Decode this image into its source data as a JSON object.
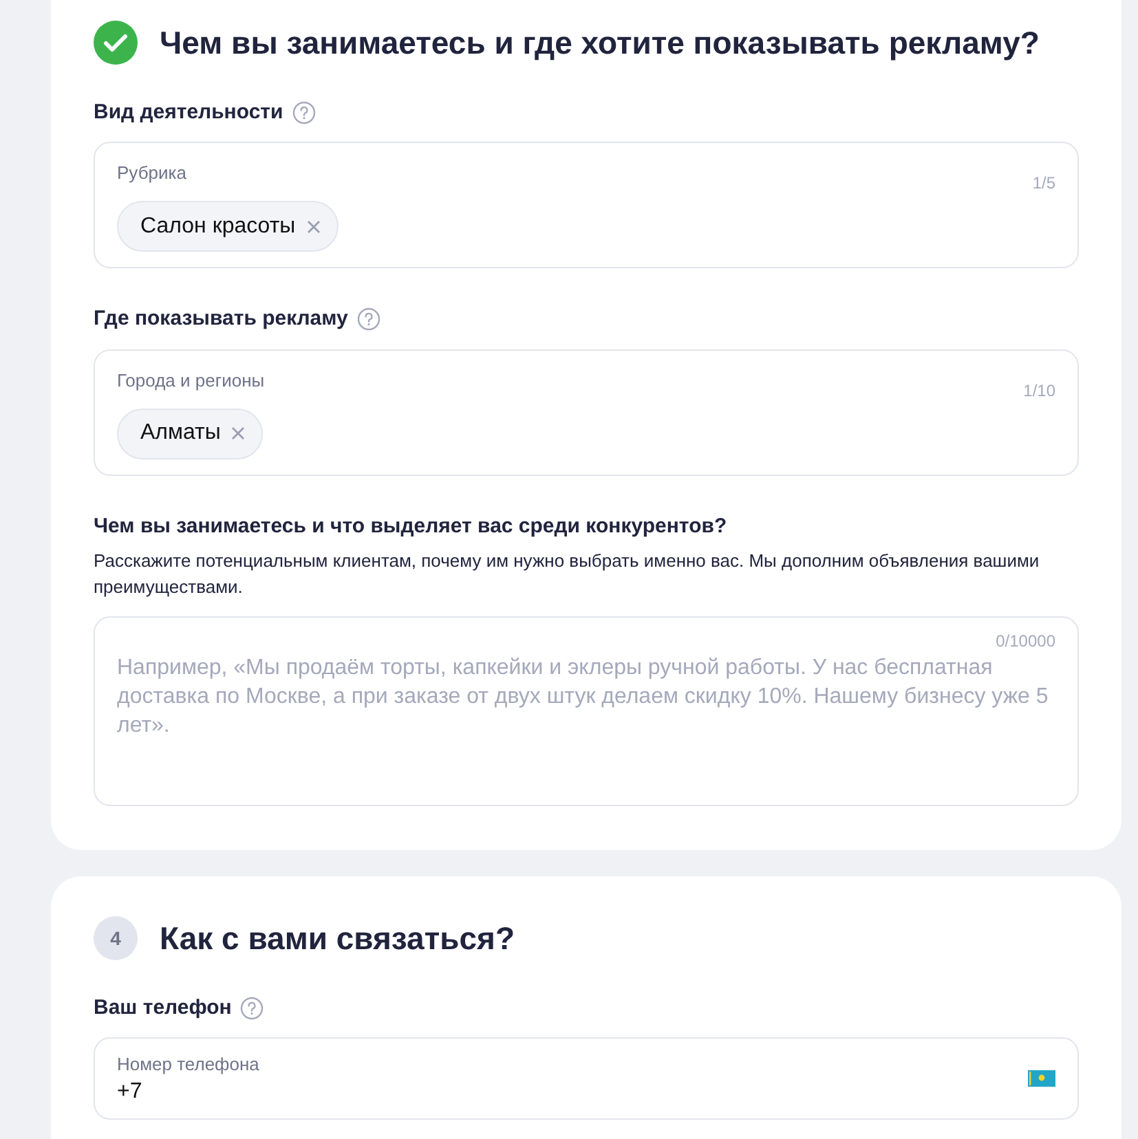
{
  "sections": [
    {
      "completed": true,
      "title": "Чем вы занимаетесь и где хотите показывать рекламу?",
      "fields": [
        {
          "kind": "tags",
          "label": "Вид деятельности",
          "help": true,
          "caption": "Рубрика",
          "counter": "1/5",
          "tags": [
            "Салон красоты"
          ]
        },
        {
          "kind": "tags",
          "label": "Где показывать рекламу",
          "help": true,
          "caption": "Города и регионы",
          "counter": "1/10",
          "tags": [
            "Алматы"
          ]
        },
        {
          "kind": "textarea",
          "label": "Чем вы занимаетесь и что выделяет вас среди конкурентов?",
          "help": false,
          "description": "Расскажите потенциальным клиентам, почему им нужно выбрать именно вас. Мы дополним объявления вашими преимуществами.",
          "counter": "0/10000",
          "placeholder": "Например, «Мы продаём торты, капкейки и эклеры ручной работы. У нас бесплатная доставка по Москве, а при заказе от двух штук делаем скидку 10%. Нашему бизнесу уже 5 лет»."
        }
      ]
    },
    {
      "completed": false,
      "number": "4",
      "title": "Как с вами связаться?",
      "fields": [
        {
          "kind": "phone",
          "label": "Ваш телефон",
          "help": true,
          "caption": "Номер телефона",
          "value": "+7"
        }
      ]
    }
  ]
}
